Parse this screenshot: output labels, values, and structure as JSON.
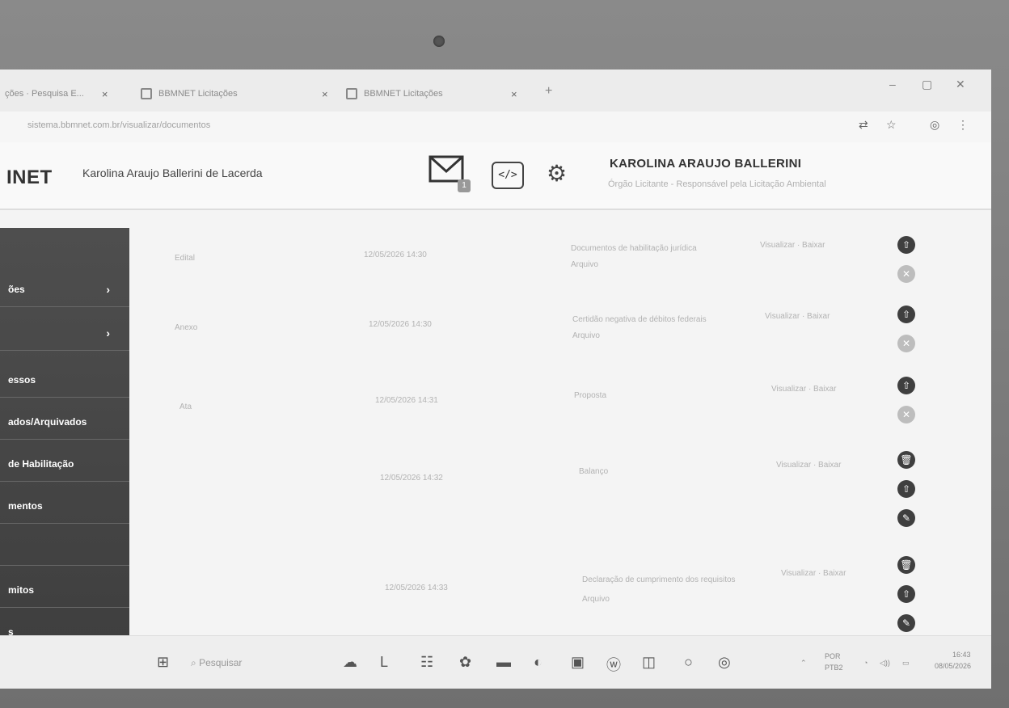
{
  "browser": {
    "tabs": [
      {
        "label": "ções · Pesquisa E..."
      },
      {
        "label": "BBMNET Licitações"
      },
      {
        "label": "BBMNET Licitações"
      }
    ],
    "new_tab": "+",
    "close": "×",
    "url": "sistema.bbmnet.com.br/visualizar/documentos",
    "win_min": "–",
    "win_max": "▢",
    "win_close": "✕"
  },
  "header": {
    "logo": "INET",
    "user": "Karolina Araujo Ballerini de Lacerda",
    "mail_badge": "1",
    "code_label": "</>",
    "profile_name": "KAROLINA ARAUJO BALLERINI",
    "profile_sub": "Órgão Licitante - Responsável pela Licitação Ambiental"
  },
  "sidebar": {
    "items": [
      {
        "label": "ões",
        "chevron": "›"
      },
      {
        "label": "",
        "chevron": "›"
      },
      {
        "label": "essos",
        "chevron": ""
      },
      {
        "label": "ados/Arquivados",
        "chevron": ""
      },
      {
        "label": "de Habilitação",
        "chevron": ""
      },
      {
        "label": "mentos",
        "chevron": ""
      },
      {
        "label": "",
        "chevron": ""
      },
      {
        "label": "mitos",
        "chevron": ""
      },
      {
        "label": "s",
        "chevron": ""
      }
    ]
  },
  "rows": [
    {
      "c1": "Edital",
      "c2": "12/05/2026 14:30",
      "c3": "Documentos de habilitação jurídica",
      "c4": "Visualizar · Baixar",
      "c5": "Arquivo"
    },
    {
      "c1": "Anexo",
      "c2": "12/05/2026 14:30",
      "c3": "Certidão negativa de débitos federais",
      "c4": "Visualizar · Baixar",
      "c5": "Arquivo"
    },
    {
      "c1": "Ata",
      "c2": "12/05/2026 14:31",
      "c3": "Proposta",
      "c4": "Visualizar · Baixar",
      "c5": ""
    },
    {
      "c1": "",
      "c2": "12/05/2026 14:32",
      "c3": "Balanço",
      "c4": "Visualizar · Baixar",
      "c5": ""
    },
    {
      "c1": "",
      "c2": "12/05/2026 14:33",
      "c3": "Declaração de cumprimento dos requisitos",
      "c4": "Visualizar · Baixar",
      "c5": "Arquivo"
    }
  ],
  "actions": {
    "upload": "⇧",
    "remove": "✕",
    "delete": "🗑",
    "edit": "✎"
  },
  "taskbar": {
    "search_placeholder": "Pesquisar",
    "lang": "POR",
    "lang2": "PTB2",
    "time": "16:43",
    "date": "08/05/2026"
  }
}
